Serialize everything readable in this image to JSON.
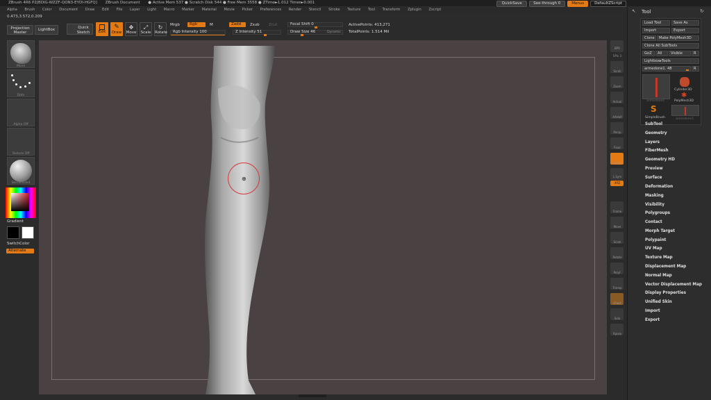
{
  "title_bar": {
    "items": [
      "ZBrush 4R6 P2[BDIG-WZZF-QON3-EYDI-HGFQ]",
      "ZBrush Document",
      "● Active Mem 537 ● Scratch Disk 544 ● Free Mem 3558 ● ZTime►1.012 Timer►0.001"
    ],
    "quicksave": "QuickSave",
    "see_through": "See-through  0",
    "menus_btn": "Menus",
    "default_script": "DefaultZScript"
  },
  "menu_bar": [
    "Alpha",
    "Brush",
    "Color",
    "Document",
    "Draw",
    "Edit",
    "File",
    "Layer",
    "Light",
    "Macro",
    "Marker",
    "Material",
    "Movie",
    "Picker",
    "Preferences",
    "Render",
    "Stencil",
    "Stroke",
    "Texture",
    "Tool",
    "Transform",
    "Zplugin",
    "Zscript"
  ],
  "coords": "0.473,3.572,0.209",
  "toolbar": {
    "projection_master": "Projection Master",
    "lightbox": "LightBox",
    "quick_sketch": "Quick Sketch",
    "edit": "Edit",
    "draw": "Draw",
    "move": "Move",
    "scale": "Scale",
    "rotate": "Rotate",
    "mrgb": "Mrgb",
    "rgb": "Rgb",
    "m": "M",
    "rgb_intensity": "Rgb Intensity 100",
    "zadd": "Zadd",
    "zsub": "Zsub",
    "zcut": "Zcut",
    "z_intensity": "Z Intensity 51",
    "focal_shift": "Focal Shift 0",
    "draw_size": "Draw Size 46",
    "dynamic": "Dynamic",
    "active_points": "ActivePoints: 413,271",
    "total_points": "TotalPoints: 1.514 Mil"
  },
  "left_panel": {
    "brush_label": "Move",
    "stroke_label": "Dots",
    "alpha_label": "Alpha Off",
    "texture_label": "Texture Off",
    "material_label": "SkinShade4",
    "gradient": "Gradient",
    "switch_color": "SwitchColor",
    "alternate": "Alternate"
  },
  "right_strip": [
    "BPR",
    "SPix 3",
    "Scroll",
    "Zoom",
    "Actual",
    "AAHalf",
    "Persp",
    "Floor",
    "Local",
    "L.Sym",
    "XYZ",
    "Frame",
    "Move",
    "Scale",
    "Rotate",
    "PolyF",
    "Transp",
    "Ghost",
    "Solo",
    "Xpose"
  ],
  "tool_panel": {
    "header": "Tool",
    "buttons": {
      "load_tool": "Load Tool",
      "save_as": "Save As",
      "import": "Import",
      "export": "Export",
      "clone": "Clone",
      "make_polymesh": "Make PolyMesh3D",
      "goz": "GoZ",
      "all": "All",
      "visible": "Visible",
      "r": "R",
      "clone_all": "Clone All SubTools",
      "lightbox_tools": "Lightbox▸Tools",
      "current_tool": "armedone1. 48",
      "r2": "R"
    },
    "thumbs": [
      "armedone1",
      "Cylinder3D",
      "PolyMesh3D",
      "SimpleBrush",
      "armedone1"
    ],
    "menu": [
      "SubTool",
      "Geometry",
      "Layers",
      "FiberMesh",
      "Geometry HD",
      "Preview",
      "Surface",
      "Deformation",
      "Masking",
      "Visibility",
      "Polygroups",
      "Contact",
      "Morph Target",
      "Polypaint",
      "UV Map",
      "Texture Map",
      "Displacement Map",
      "Normal Map",
      "Vector Displacement Map",
      "Display Properties",
      "Unified Skin",
      "Import",
      "Export"
    ]
  },
  "colors": {
    "accent": "#e47a14",
    "viewport_bg": "#4a4143",
    "panel_bg": "#2b2b2b"
  }
}
